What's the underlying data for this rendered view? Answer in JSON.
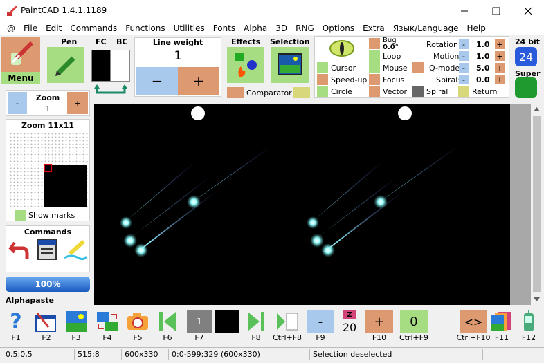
{
  "window": {
    "title": "PaintCAD 1.4.1.1189"
  },
  "menu": [
    "@",
    "File",
    "Edit",
    "Commands",
    "Functions",
    "Utilities",
    "Fonts",
    "Alpha",
    "3D",
    "RNG",
    "Options",
    "Extra",
    "Язык/Language",
    "Help"
  ],
  "left": {
    "menu_label": "Menu",
    "pen_label": "Pen",
    "fc_label": "FC",
    "bc_label": "BC",
    "zoom_title": "Zoom",
    "zoom_value": "1",
    "zoom_minus": "-",
    "zoom_plus": "+",
    "zoom_view_title": "Zoom 11x11",
    "show_marks": "Show marks",
    "commands_title": "Commands",
    "progress": "100%",
    "alphapaste": "Alphapaste"
  },
  "lineweight": {
    "title": "Line weight",
    "value": "1",
    "minus": "−",
    "plus": "+"
  },
  "effects": {
    "title": "Effects",
    "comparator": "Comparator"
  },
  "selection": {
    "title": "Selection"
  },
  "modes": {
    "cursor": "Cursor",
    "speedup": "Speed-up",
    "circle": "Circle",
    "bug": "Bug",
    "bug_value": "0.0°",
    "loop": "Loop",
    "mouse": "Mouse",
    "focus": "Focus",
    "vector": "Vector",
    "spiral": "Spiral",
    "return": "Return",
    "rotation": "Rotation:",
    "rotation_v": "1.0",
    "motion": "Motion:",
    "motion_v": "1.0",
    "qmode": "Q-mode:",
    "qmode_v": "5.0",
    "spiral_l": "Spiral:",
    "spiral_v": "0.0",
    "minus": "-",
    "plus": "+"
  },
  "bits": {
    "label": "24 bit",
    "value": "24",
    "super": "Super"
  },
  "fkeys": {
    "f1": "F1",
    "f2": "F2",
    "f3": "F3",
    "f4": "F4",
    "f5": "F5",
    "f6": "F6",
    "f7": "F7",
    "f7_value": "1",
    "f8": "F8",
    "ctrlf8": "Ctrl+F8",
    "f9": "F9",
    "f9_label": "-",
    "counter": "20",
    "counter_label": "Z",
    "f10": "F10",
    "f10_label": "+",
    "ctrlf9": "Ctrl+F9",
    "ctrlf9_label": "0",
    "ctrlf10": "Ctrl+F10",
    "ctrlf10_label": "<>",
    "f11": "F11",
    "f12": "F12"
  },
  "status": {
    "coord": "0,5:0,5",
    "cursor": "515:8",
    "size": "600x330",
    "range": "0:0-599:329 (600x330)",
    "message": "Selection deselected"
  }
}
